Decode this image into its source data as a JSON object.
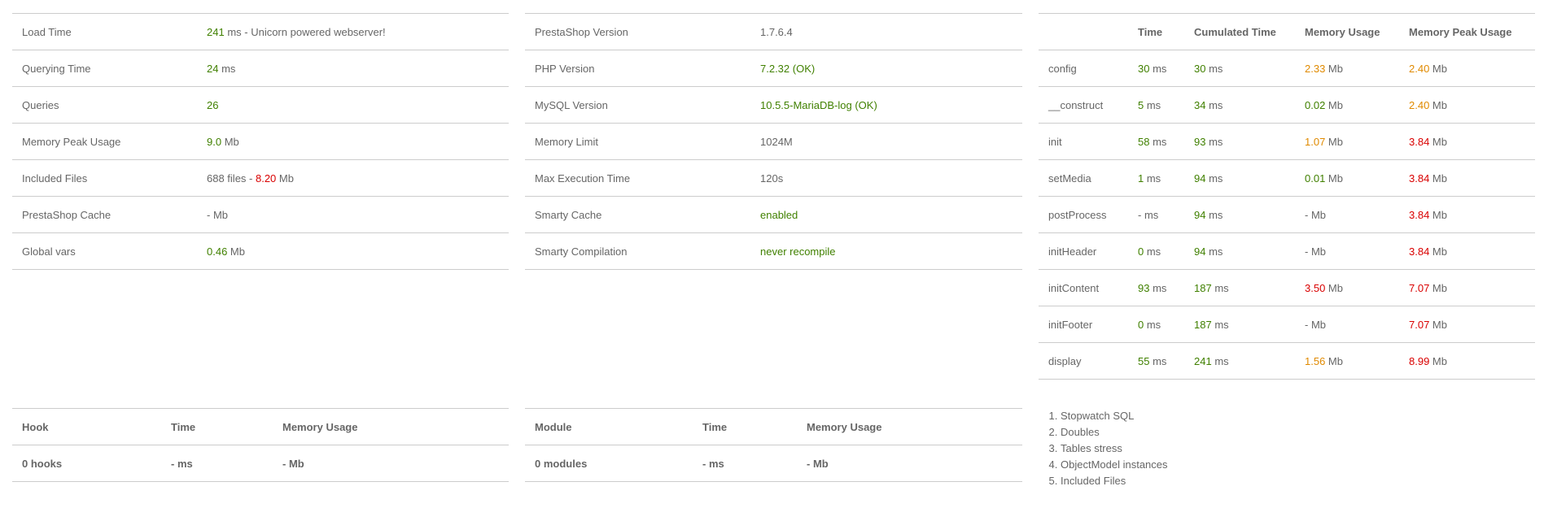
{
  "summary": {
    "rows": [
      {
        "label": "Load Time",
        "parts": [
          {
            "t": "241",
            "c": "g"
          },
          {
            "t": " ms - Unicorn powered webserver!",
            "c": "n"
          }
        ]
      },
      {
        "label": "Querying Time",
        "parts": [
          {
            "t": "24",
            "c": "g"
          },
          {
            "t": " ms",
            "c": "n"
          }
        ]
      },
      {
        "label": "Queries",
        "parts": [
          {
            "t": "26",
            "c": "g"
          }
        ]
      },
      {
        "label": "Memory Peak Usage",
        "parts": [
          {
            "t": "9.0",
            "c": "g"
          },
          {
            "t": " Mb",
            "c": "n"
          }
        ]
      },
      {
        "label": "Included Files",
        "parts": [
          {
            "t": "688 files - ",
            "c": "n"
          },
          {
            "t": "8.20",
            "c": "r"
          },
          {
            "t": " Mb",
            "c": "n"
          }
        ]
      },
      {
        "label": "PrestaShop Cache",
        "parts": [
          {
            "t": "- Mb",
            "c": "n"
          }
        ]
      },
      {
        "label": "Global vars",
        "parts": [
          {
            "t": "0.46",
            "c": "g"
          },
          {
            "t": " Mb",
            "c": "n"
          }
        ]
      }
    ]
  },
  "config": {
    "rows": [
      {
        "label": "PrestaShop Version",
        "parts": [
          {
            "t": "1.7.6.4",
            "c": "n"
          }
        ]
      },
      {
        "label": "PHP Version",
        "parts": [
          {
            "t": "7.2.32 (OK)",
            "c": "g"
          }
        ]
      },
      {
        "label": "MySQL Version",
        "parts": [
          {
            "t": "10.5.5-MariaDB-log (OK)",
            "c": "g"
          }
        ]
      },
      {
        "label": "Memory Limit",
        "parts": [
          {
            "t": "1024M",
            "c": "n"
          }
        ]
      },
      {
        "label": "Max Execution Time",
        "parts": [
          {
            "t": "120s",
            "c": "n"
          }
        ]
      },
      {
        "label": "Smarty Cache",
        "parts": [
          {
            "t": "enabled",
            "c": "g"
          }
        ]
      },
      {
        "label": "Smarty Compilation",
        "parts": [
          {
            "t": "never recompile",
            "c": "g"
          }
        ]
      }
    ]
  },
  "timing": {
    "headers": [
      "",
      "Time",
      "Cumulated Time",
      "Memory Usage",
      "Memory Peak Usage"
    ],
    "rows": [
      {
        "step": "config",
        "time": [
          "30",
          "g"
        ],
        "cum": [
          "30",
          "g"
        ],
        "mem": [
          "2.33",
          "o"
        ],
        "peak": [
          "2.40",
          "o"
        ]
      },
      {
        "step": "__construct",
        "time": [
          "5",
          "g"
        ],
        "cum": [
          "34",
          "g"
        ],
        "mem": [
          "0.02",
          "g"
        ],
        "peak": [
          "2.40",
          "o"
        ]
      },
      {
        "step": "init",
        "time": [
          "58",
          "g"
        ],
        "cum": [
          "93",
          "g"
        ],
        "mem": [
          "1.07",
          "o"
        ],
        "peak": [
          "3.84",
          "r"
        ]
      },
      {
        "step": "setMedia",
        "time": [
          "1",
          "g"
        ],
        "cum": [
          "94",
          "g"
        ],
        "mem": [
          "0.01",
          "g"
        ],
        "peak": [
          "3.84",
          "r"
        ]
      },
      {
        "step": "postProcess",
        "time": [
          "-",
          "n"
        ],
        "cum": [
          "94",
          "g"
        ],
        "mem": [
          "-",
          "n"
        ],
        "peak": [
          "3.84",
          "r"
        ]
      },
      {
        "step": "initHeader",
        "time": [
          "0",
          "g"
        ],
        "cum": [
          "94",
          "g"
        ],
        "mem": [
          "-",
          "n"
        ],
        "peak": [
          "3.84",
          "r"
        ]
      },
      {
        "step": "initContent",
        "time": [
          "93",
          "g"
        ],
        "cum": [
          "187",
          "g"
        ],
        "mem": [
          "3.50",
          "r"
        ],
        "peak": [
          "7.07",
          "r"
        ]
      },
      {
        "step": "initFooter",
        "time": [
          "0",
          "g"
        ],
        "cum": [
          "187",
          "g"
        ],
        "mem": [
          "-",
          "n"
        ],
        "peak": [
          "7.07",
          "r"
        ]
      },
      {
        "step": "display",
        "time": [
          "55",
          "g"
        ],
        "cum": [
          "241",
          "g"
        ],
        "mem": [
          "1.56",
          "o"
        ],
        "peak": [
          "8.99",
          "r"
        ]
      }
    ],
    "unit_ms": " ms",
    "unit_mb": " Mb"
  },
  "hooks": {
    "headers": [
      "Hook",
      "Time",
      "Memory Usage"
    ],
    "total": [
      "0 hooks",
      "- ms",
      "- Mb"
    ]
  },
  "modules": {
    "headers": [
      "Module",
      "Time",
      "Memory Usage"
    ],
    "total": [
      "0 modules",
      "- ms",
      "- Mb"
    ]
  },
  "toc": {
    "items": [
      "Stopwatch SQL",
      "Doubles",
      "Tables stress",
      "ObjectModel instances",
      "Included Files"
    ]
  },
  "colors": {
    "green": "#408000",
    "orange": "#e08a00",
    "red": "#d90000",
    "text": "#666666",
    "border": "#cccccc"
  }
}
